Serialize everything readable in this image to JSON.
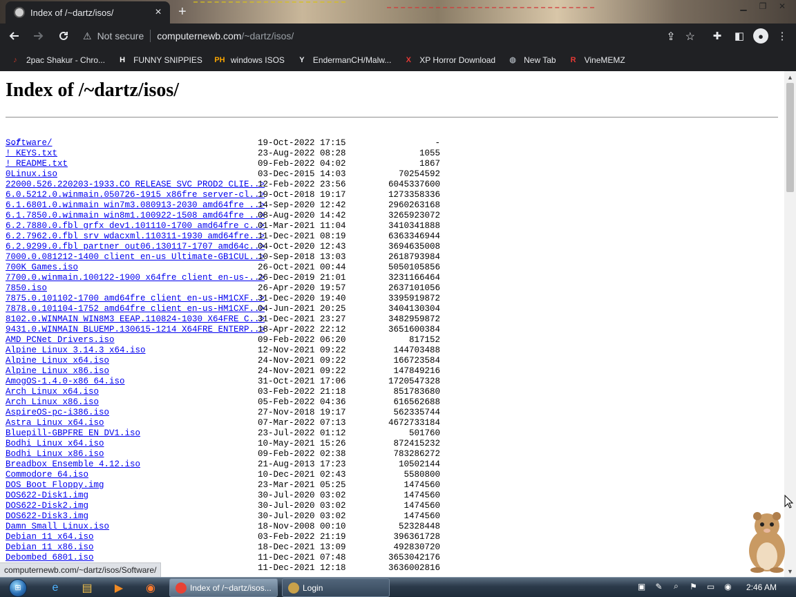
{
  "browser": {
    "tab_title": "Index of /~dartz/isos/",
    "tab_close": "×",
    "new_tab": "+",
    "security_label": "Not secure",
    "url_host": "computernewb.com",
    "url_path": "/~dartz/isos/",
    "status_url": "computernewb.com/~dartz/isos/Software/"
  },
  "bookmarks": [
    {
      "label": "2pac Shakur - Chro...",
      "icon": "music-icon",
      "icon_text": "♪",
      "icon_color": "#c0392b"
    },
    {
      "label": "FUNNY SNIPPIES",
      "icon": "h-icon",
      "icon_text": "H",
      "icon_color": "#ffffff"
    },
    {
      "label": "windows ISOS",
      "icon": "ph-icon",
      "icon_text": "PH",
      "icon_color": "#f7a400"
    },
    {
      "label": "EndermanCH/Malw...",
      "icon": "yp-icon",
      "icon_text": "Y",
      "icon_color": "#e8eaed"
    },
    {
      "label": "XP Horror Download",
      "icon": "x-icon",
      "icon_text": "X",
      "icon_color": "#e53935"
    },
    {
      "label": "New Tab",
      "icon": "globe-icon",
      "icon_text": "◍",
      "icon_color": "#9aa0a6"
    },
    {
      "label": "VineMEMZ",
      "icon": "r-icon",
      "icon_text": "R",
      "icon_color": "#e53935"
    }
  ],
  "page": {
    "heading": "Index of /~dartz/isos/",
    "parent_link": "../",
    "entries": [
      {
        "name": "Software/",
        "date": "19-Oct-2022 17:15",
        "size": "-"
      },
      {
        "name": "! KEYS.txt",
        "date": "23-Aug-2022 08:28",
        "size": "1055"
      },
      {
        "name": "! README.txt",
        "date": "09-Feb-2022 04:02",
        "size": "1867"
      },
      {
        "name": "0Linux.iso",
        "date": "03-Dec-2015 14:03",
        "size": "70254592"
      },
      {
        "name": "22000.526.220203-1933.CO_RELEASE_SVC_PROD2_CLIE..>",
        "date": "12-Feb-2022 23:56",
        "size": "6045337600"
      },
      {
        "name": "6.0.5212.0.winmain.050726-1915_x86fre_server-cl..>",
        "date": "19-Oct-2018 19:17",
        "size": "1273358336"
      },
      {
        "name": "6.1.6801.0.winmain_win7m3.080913-2030_amd64fre_..>",
        "date": "14-Sep-2020 12:42",
        "size": "2960263168"
      },
      {
        "name": "6.1.7850.0.winmain_win8m1.100922-1508_amd64fre_..>",
        "date": "08-Aug-2020 14:42",
        "size": "3265923072"
      },
      {
        "name": "6.2.7880.0.fbl_grfx_dev1.101110-1700_amd64fre_c..>",
        "date": "01-Mar-2021 11:04",
        "size": "3410341888"
      },
      {
        "name": "6.2.7962.0.fbl_srv_wdacxml.110311-1930_amd64fre..>",
        "date": "11-Dec-2021 08:19",
        "size": "6363346944"
      },
      {
        "name": "6.2.9299.0.fbl_partner_out06.130117-1707_amd64c..>",
        "date": "04-Oct-2020 12:43",
        "size": "3694635008"
      },
      {
        "name": "7000.0.081212-1400_client_en-us_Ultimate-GB1CUL..>",
        "date": "10-Sep-2018 13:03",
        "size": "2618793984"
      },
      {
        "name": "700K Games.iso",
        "date": "26-Oct-2021 00:44",
        "size": "5050105856"
      },
      {
        "name": "7700.0.winmain.100122-1900_x64fre_client_en-us-..>",
        "date": "26-Dec-2019 21:01",
        "size": "3231166464"
      },
      {
        "name": "7850.iso",
        "date": "26-Apr-2020 19:57",
        "size": "2637101056"
      },
      {
        "name": "7875.0.101102-1700_amd64fre_client_en-us-HM1CXF..>",
        "date": "31-Dec-2020 19:40",
        "size": "3395919872"
      },
      {
        "name": "7878.0.101104-1752_amd64fre_client_en-us-HM1CXF..>",
        "date": "04-Jun-2021 20:25",
        "size": "3404130304"
      },
      {
        "name": "8102.0.WINMAIN_WIN8M3_EEAP.110824-1030_X64FRE_C..>",
        "date": "31-Dec-2021 23:27",
        "size": "3482959872"
      },
      {
        "name": "9431.0.WINMAIN_BLUEMP.130615-1214_X64FRE_ENTERP..>",
        "date": "18-Apr-2022 22:12",
        "size": "3651600384"
      },
      {
        "name": "AMD PCNet Drivers.iso",
        "date": "09-Feb-2022 06:20",
        "size": "817152"
      },
      {
        "name": "Alpine Linux 3.14.3 x64.iso",
        "date": "12-Nov-2021 09:22",
        "size": "144703488"
      },
      {
        "name": "Alpine Linux x64.iso",
        "date": "24-Nov-2021 09:22",
        "size": "166723584"
      },
      {
        "name": "Alpine Linux x86.iso",
        "date": "24-Nov-2021 09:22",
        "size": "147849216"
      },
      {
        "name": "AmogOS-1.4.0-x86_64.iso",
        "date": "31-Oct-2021 17:06",
        "size": "1720547328"
      },
      {
        "name": "Arch Linux x64.iso",
        "date": "03-Feb-2022 21:18",
        "size": "851783680"
      },
      {
        "name": "Arch Linux x86.iso",
        "date": "05-Feb-2022 04:36",
        "size": "616562688"
      },
      {
        "name": "AspireOS-pc-i386.iso",
        "date": "27-Nov-2018 19:17",
        "size": "562335744"
      },
      {
        "name": "Astra Linux x64.iso",
        "date": "07-Mar-2022 07:13",
        "size": "4672733184"
      },
      {
        "name": "Bluepill-GBPFRE_EN_DV1.iso",
        "date": "23-Jul-2022 01:12",
        "size": "501760"
      },
      {
        "name": "Bodhi Linux x64.iso",
        "date": "10-May-2021 15:26",
        "size": "872415232"
      },
      {
        "name": "Bodhi Linux x86.iso",
        "date": "09-Feb-2022 02:38",
        "size": "783286272"
      },
      {
        "name": "Breadbox Ensemble 4.12.iso",
        "date": "21-Aug-2013 17:23",
        "size": "10502144"
      },
      {
        "name": "Commodore 64.iso",
        "date": "10-Dec-2021 02:43",
        "size": "5580800"
      },
      {
        "name": "DOS Boot Floppy.img",
        "date": "23-Mar-2021 05:25",
        "size": "1474560"
      },
      {
        "name": "DOS622-Disk1.img",
        "date": "30-Jul-2020 03:02",
        "size": "1474560"
      },
      {
        "name": "DOS622-Disk2.img",
        "date": "30-Jul-2020 03:02",
        "size": "1474560"
      },
      {
        "name": "DOS622-Disk3.img",
        "date": "30-Jul-2020 03:02",
        "size": "1474560"
      },
      {
        "name": "Damn Small Linux.iso",
        "date": "18-Nov-2008 00:10",
        "size": "52328448"
      },
      {
        "name": "Debian 11 x64.iso",
        "date": "03-Feb-2022 21:19",
        "size": "396361728"
      },
      {
        "name": "Debian 11 x86.iso",
        "date": "18-Dec-2021 13:09",
        "size": "492830720"
      },
      {
        "name": "Debombed 6801.iso",
        "date": "11-Dec-2021 07:48",
        "size": "3653042176"
      },
      {
        "name": "",
        "date": "11-Dec-2021 12:18",
        "size": "3636002816"
      }
    ]
  },
  "taskbar": {
    "start_label": "⊞",
    "pinned": [
      {
        "name": "ie-icon",
        "glyph": "e",
        "color": "#4fb3ff"
      },
      {
        "name": "explorer-icon",
        "glyph": "▤",
        "color": "#f2c14e"
      },
      {
        "name": "media-player-icon",
        "glyph": "▶",
        "color": "#f08a24"
      },
      {
        "name": "firefox-icon",
        "glyph": "◉",
        "color": "#ff7b2e"
      }
    ],
    "tasks": [
      {
        "label": "Index of /~dartz/isos...",
        "active": true,
        "icon_color": "#e84235"
      },
      {
        "label": "Login",
        "active": false,
        "icon_color": "#c9a14a"
      }
    ],
    "tray": [
      {
        "name": "network-tray-icon",
        "glyph": "▣"
      },
      {
        "name": "pen-tray-icon",
        "glyph": "✎"
      },
      {
        "name": "search-tray-icon",
        "glyph": "⌕"
      },
      {
        "name": "flag-tray-icon",
        "glyph": "⚑"
      },
      {
        "name": "monitor-tray-icon",
        "glyph": "▭"
      },
      {
        "name": "volume-tray-icon",
        "glyph": "◉"
      }
    ],
    "clock": "2:46 AM"
  },
  "colors": {
    "link": "#0000ee",
    "chrome_dark": "#202124"
  }
}
